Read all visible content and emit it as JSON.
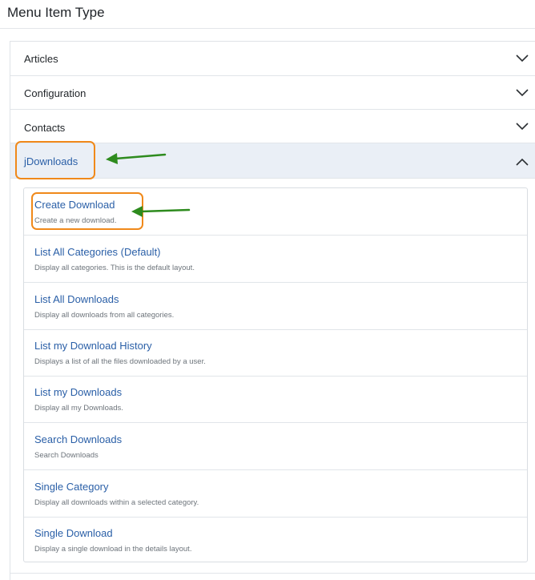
{
  "page": {
    "title": "Menu Item Type"
  },
  "accordion": {
    "sections": [
      {
        "label": "Articles",
        "icon": "chevron-down-icon",
        "expanded": false
      },
      {
        "label": "Configuration",
        "icon": "chevron-down-icon",
        "expanded": false
      },
      {
        "label": "Contacts",
        "icon": "chevron-down-icon",
        "expanded": false
      },
      {
        "label": "jDownloads",
        "icon": "chevron-up-icon",
        "expanded": true
      }
    ],
    "items": [
      {
        "name": "Create Download",
        "description": "Create a new download."
      },
      {
        "name": "List All Categories (Default)",
        "description": "Display all categories. This is the default layout."
      },
      {
        "name": "List All Downloads",
        "description": "Display all downloads from all categories."
      },
      {
        "name": "List my Download History",
        "description": "Displays a list of all the files downloaded by a user."
      },
      {
        "name": "List my Downloads",
        "description": "Display all my Downloads."
      },
      {
        "name": "Search Downloads",
        "description": "Search Downloads"
      },
      {
        "name": "Single Category",
        "description": "Display all downloads within a selected category."
      },
      {
        "name": "Single Download",
        "description": "Display a single download in the details layout."
      }
    ]
  },
  "annotations": {
    "highlight_color": "#f0891a",
    "arrow_color": "#2e8b1e",
    "highlighted": [
      "jDownloads",
      "Create Download"
    ]
  },
  "colors": {
    "link": "#2a5fa7",
    "active_header_bg": "#eaeff6"
  }
}
